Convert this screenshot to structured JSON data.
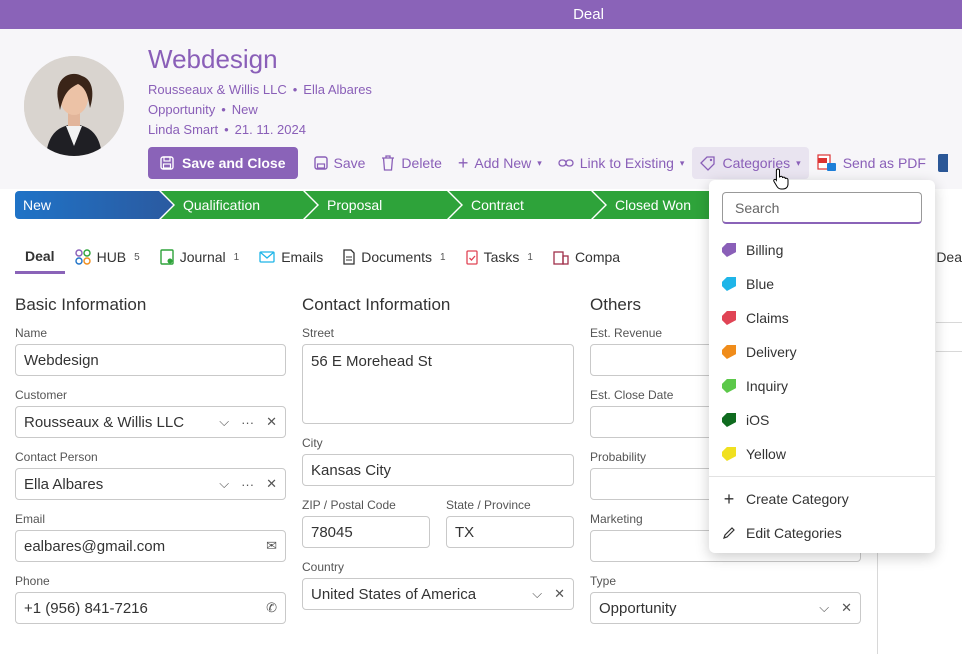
{
  "window": {
    "title": "Deal"
  },
  "deal": {
    "title": "Webdesign",
    "company": "Rousseaux & Willis LLC",
    "contact": "Ella Albares",
    "type": "Opportunity",
    "status": "New",
    "owner": "Linda Smart",
    "date": "21. 11. 2024"
  },
  "toolbar": {
    "save_close": "Save and Close",
    "save": "Save",
    "delete": "Delete",
    "add_new": "Add New",
    "link_existing": "Link to Existing",
    "categories": "Categories",
    "send_pdf": "Send as PDF"
  },
  "stages": [
    "New",
    "Qualification",
    "Proposal",
    "Contract",
    "Closed Won"
  ],
  "tabs": [
    {
      "label": "Deal",
      "count": ""
    },
    {
      "label": "HUB",
      "count": "5"
    },
    {
      "label": "Journal",
      "count": "1"
    },
    {
      "label": "Emails",
      "count": ""
    },
    {
      "label": "Documents",
      "count": "1"
    },
    {
      "label": "Tasks",
      "count": "1"
    },
    {
      "label": "Compa",
      "count": ""
    },
    {
      "label": "Dea",
      "count": ""
    }
  ],
  "basic": {
    "title": "Basic Information",
    "name_label": "Name",
    "name": "Webdesign",
    "customer_label": "Customer",
    "customer": "Rousseaux & Willis LLC",
    "contact_label": "Contact Person",
    "contact": "Ella Albares",
    "email_label": "Email",
    "email": "ealbares@gmail.com",
    "phone_label": "Phone",
    "phone": "+1 (956) 841-7216"
  },
  "contact_info": {
    "title": "Contact Information",
    "street_label": "Street",
    "street": "56 E Morehead St",
    "city_label": "City",
    "city": "Kansas City",
    "zip_label": "ZIP / Postal Code",
    "zip": "78045",
    "state_label": "State / Province",
    "state": "TX",
    "country_label": "Country",
    "country": "United States of America"
  },
  "others": {
    "title": "Others",
    "revenue_label": "Est. Revenue",
    "close_label": "Est. Close Date",
    "probability_label": "Probability",
    "marketing_label": "Marketing",
    "type_label": "Type",
    "type": "Opportunity"
  },
  "categories_menu": {
    "search_placeholder": "Search",
    "items": [
      {
        "label": "Billing",
        "color": "#8a5fb8"
      },
      {
        "label": "Blue",
        "color": "#1fb5e8"
      },
      {
        "label": "Claims",
        "color": "#e04455"
      },
      {
        "label": "Delivery",
        "color": "#f08c1a"
      },
      {
        "label": "Inquiry",
        "color": "#5cc84a"
      },
      {
        "label": "iOS",
        "color": "#0f6b1f"
      },
      {
        "label": "Yellow",
        "color": "#f0e020"
      }
    ],
    "create": "Create Category",
    "edit": "Edit Categories"
  }
}
